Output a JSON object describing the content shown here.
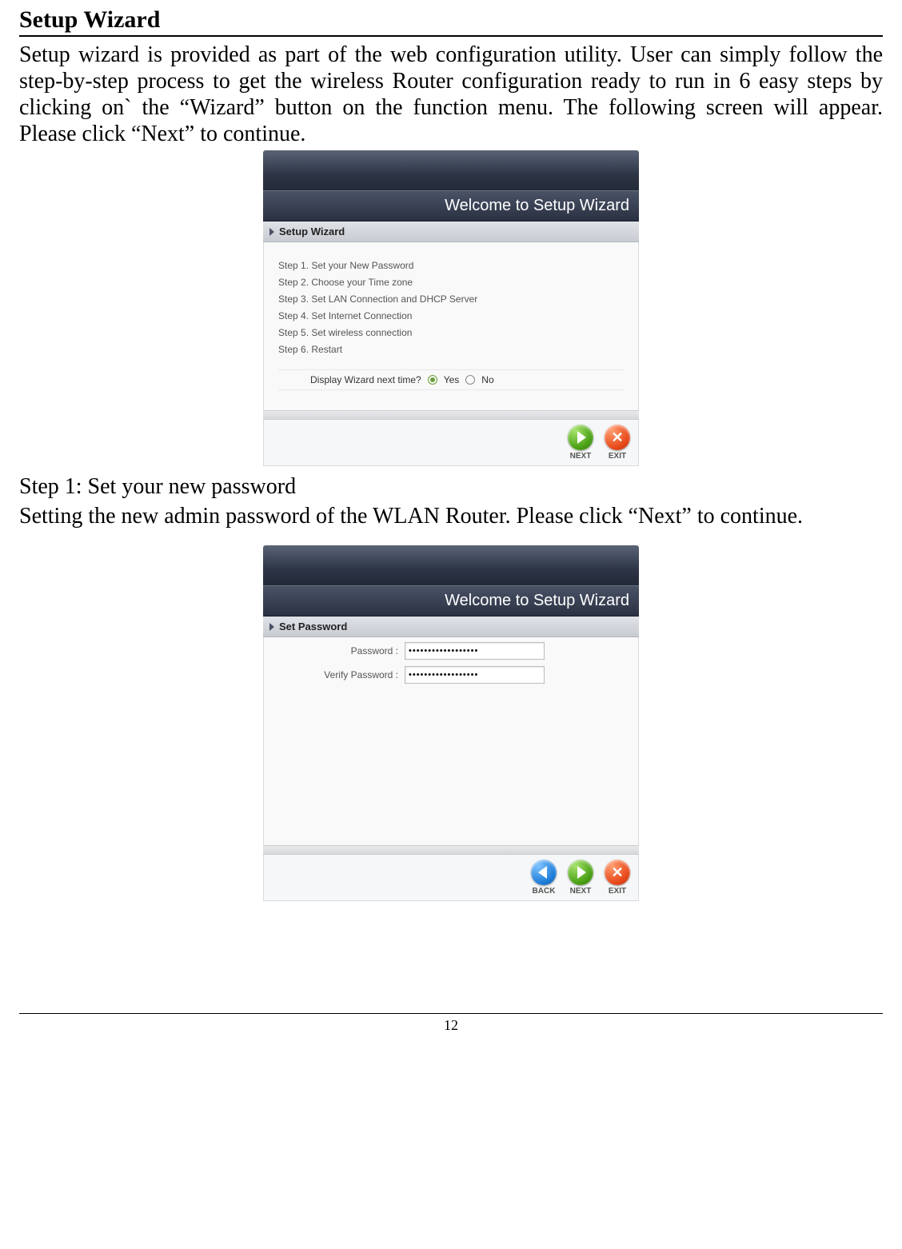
{
  "doc": {
    "section_title": "Setup Wizard",
    "intro": "Setup wizard is provided as part of the web configuration utility. User can simply follow the step-by-step process to get the wireless Router configuration ready to run in 6 easy steps by clicking on` the “Wizard” button on the function menu. The following screen will appear. Please click “Next” to continue.",
    "step1_title": "Step 1: Set your new password",
    "step1_body": "Setting the new admin password of the WLAN Router. Please click “Next” to continue.",
    "page_number": "12"
  },
  "wizard1": {
    "welcome": "Welcome to Setup Wizard",
    "subhead": "Setup Wizard",
    "steps": [
      "Step 1. Set your New Password",
      "Step 2. Choose your Time zone",
      "Step 3. Set LAN Connection and DHCP Server",
      "Step 4. Set Internet Connection",
      "Step 5. Set wireless connection",
      "Step 6. Restart"
    ],
    "display_prompt": "Display Wizard next time?",
    "yes": "Yes",
    "no": "No",
    "next": "NEXT",
    "exit": "EXIT"
  },
  "wizard2": {
    "welcome": "Welcome to Setup Wizard",
    "subhead": "Set Password",
    "password_label": "Password :",
    "verify_label": "Verify Password :",
    "password_value": "••••••••••••••••••",
    "verify_value": "••••••••••••••••••",
    "back": "BACK",
    "next": "NEXT",
    "exit": "EXIT"
  }
}
